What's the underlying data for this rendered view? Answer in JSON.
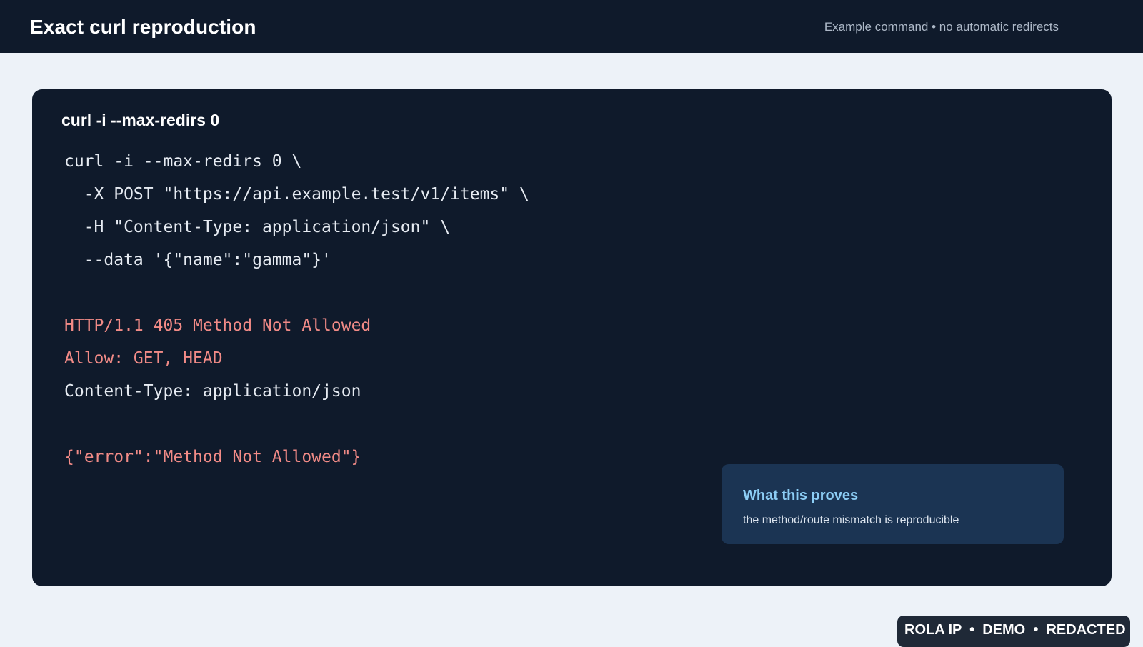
{
  "header": {
    "title": "Exact curl reproduction",
    "subtitle": "Example command • no automatic redirects"
  },
  "panel": {
    "title": "curl -i --max-redirs 0",
    "command_lines": [
      "curl -i --max-redirs 0 \\",
      "  -X POST \"https://api.example.test/v1/items\" \\",
      "  -H \"Content-Type: application/json\" \\",
      "  --data '{\"name\":\"gamma\"}'"
    ],
    "response_lines": [
      "HTTP/1.1 405 Method Not Allowed",
      "Allow: GET, HEAD",
      "Content-Type: application/json"
    ],
    "body_line": "{\"error\":\"Method Not Allowed\"}"
  },
  "note": {
    "title": "What this proves",
    "text": "the method/route mismatch is reproducible"
  },
  "watermark": {
    "text": "ROLA IP  •  DEMO  •  REDACTED"
  },
  "colors": {
    "background": "#edf2f8",
    "panel": "#0f1a2b",
    "error_text": "#f28b87",
    "note_title": "#8ccdf5",
    "note_card": "#1b3453"
  }
}
